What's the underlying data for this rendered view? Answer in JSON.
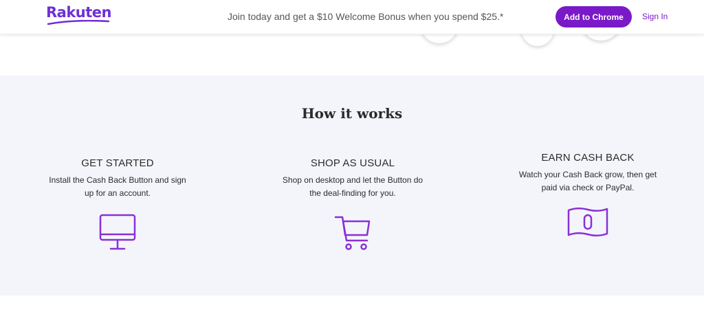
{
  "header": {
    "logo": "Rakuten",
    "promo": "Join today and get a $10 Welcome Bonus when you spend $25.*",
    "add_button": "Add to Chrome",
    "sign_in": "Sign In"
  },
  "how_it_works": {
    "title": "How it works",
    "steps": [
      {
        "title": "GET STARTED",
        "desc_line1": "Install the Cash Back Button and sign",
        "desc_line2": "up for an account.",
        "icon": "monitor-icon"
      },
      {
        "title": "SHOP AS USUAL",
        "desc_line1": "Shop on desktop and let the Button do",
        "desc_line2": "the deal-finding for you.",
        "icon": "shopping-cart-icon"
      },
      {
        "title": "EARN CASH BACK",
        "desc_line1": "Watch your Cash Back grow, then get",
        "desc_line2": "paid via check or PayPal.",
        "icon": "money-bill-icon"
      }
    ]
  },
  "colors": {
    "brand_purple": "#7a19c7",
    "section_bg": "#f4f5fb"
  }
}
